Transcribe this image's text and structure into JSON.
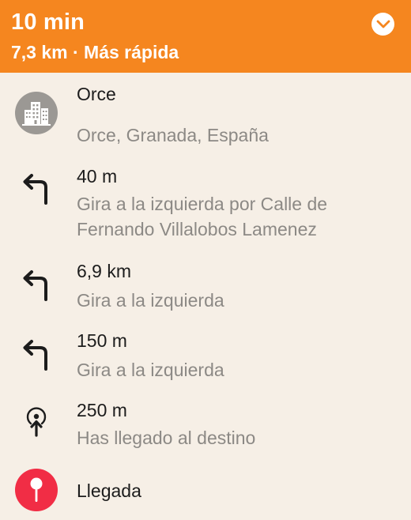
{
  "header": {
    "duration": "10 min",
    "summary": "7,3 km · Más rápida",
    "collapse_icon": "chevron-down-circle-icon",
    "accent_color": "#f5861f"
  },
  "steps": [
    {
      "icon": "city-buildings-icon",
      "title": "Orce",
      "description": "Orce, Granada, España"
    },
    {
      "icon": "turn-left-arrow-icon",
      "title": "40 m",
      "description": "Gira a la izquierda por Calle de Fernando Villalobos Lamenez"
    },
    {
      "icon": "turn-left-arrow-icon",
      "title": "6,9 km",
      "description": "Gira a la izquierda"
    },
    {
      "icon": "turn-left-arrow-icon",
      "title": "150 m",
      "description": "Gira a la izquierda"
    },
    {
      "icon": "arrive-destination-icon",
      "title": "250 m",
      "description": "Has llegado al destino"
    },
    {
      "icon": "map-pin-icon",
      "title": "Llegada",
      "description": ""
    }
  ]
}
